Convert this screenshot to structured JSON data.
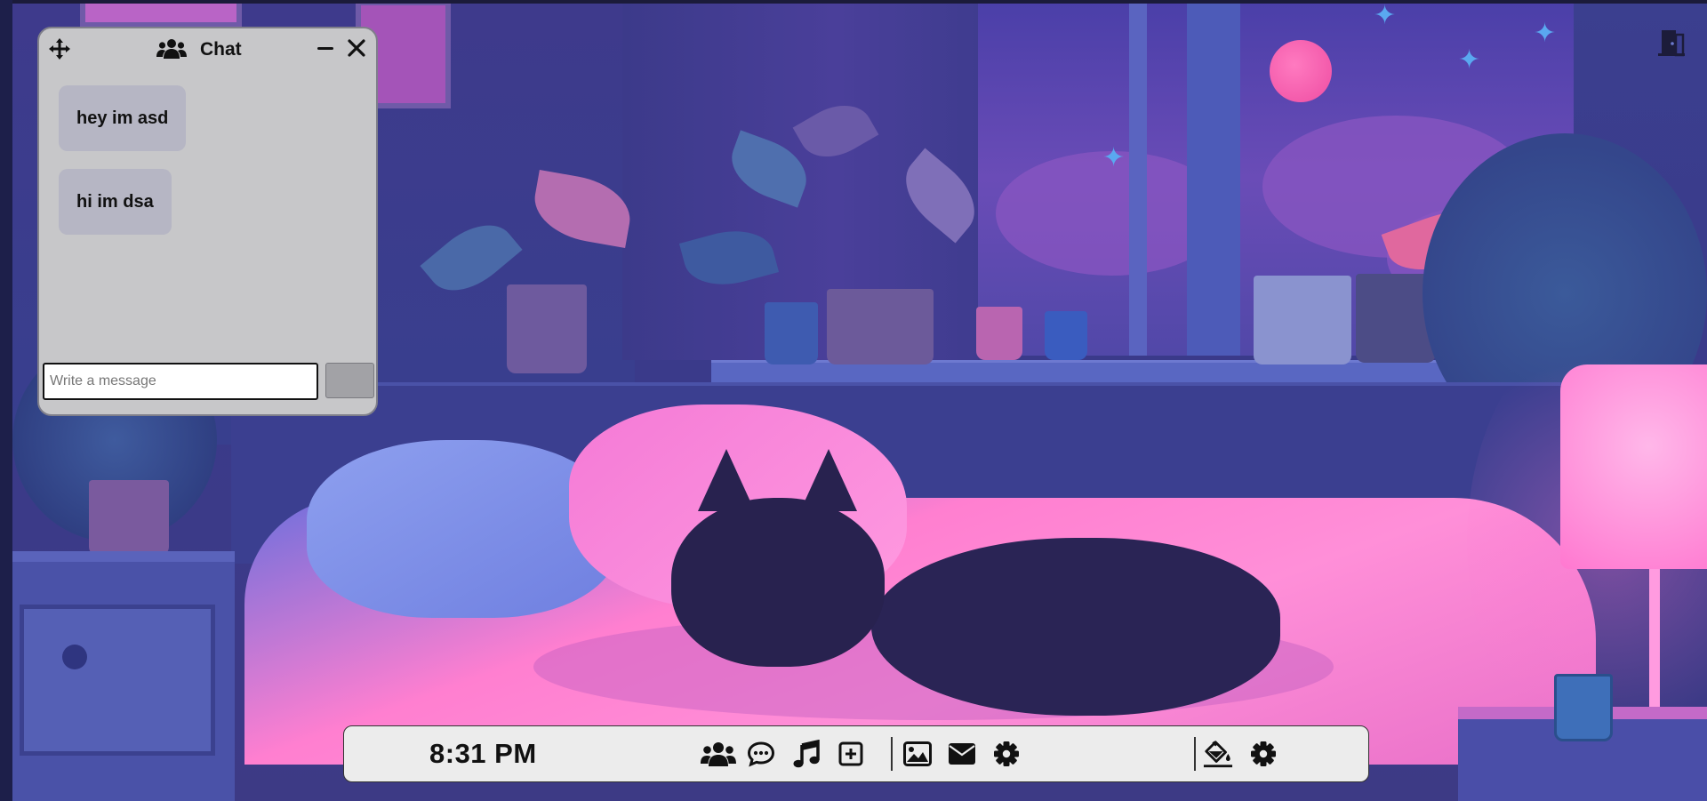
{
  "chat": {
    "title": "Chat",
    "messages": [
      {
        "text": "hey im asd"
      },
      {
        "text": "hi im dsa"
      }
    ],
    "input_placeholder": "Write a message",
    "input_value": ""
  },
  "taskbar": {
    "clock": "8:31 PM",
    "apps": [
      "users-icon",
      "chat-bubble-icon",
      "music-note-icon",
      "plus-square-icon"
    ],
    "tools": [
      "image-icon",
      "envelope-icon",
      "gear-icon"
    ],
    "system": [
      "paint-bucket-icon",
      "gear-icon"
    ]
  },
  "icons": {
    "header": [
      "move-arrows-icon",
      "users-icon",
      "minimize-icon",
      "close-icon"
    ],
    "top_right": "door-exit-icon"
  },
  "colors": {
    "chat_bg": "#c7c7c9",
    "bubble_bg": "#b6b6c4",
    "taskbar_bg": "#ececec",
    "send_button_bg": "#a2a2a6"
  }
}
